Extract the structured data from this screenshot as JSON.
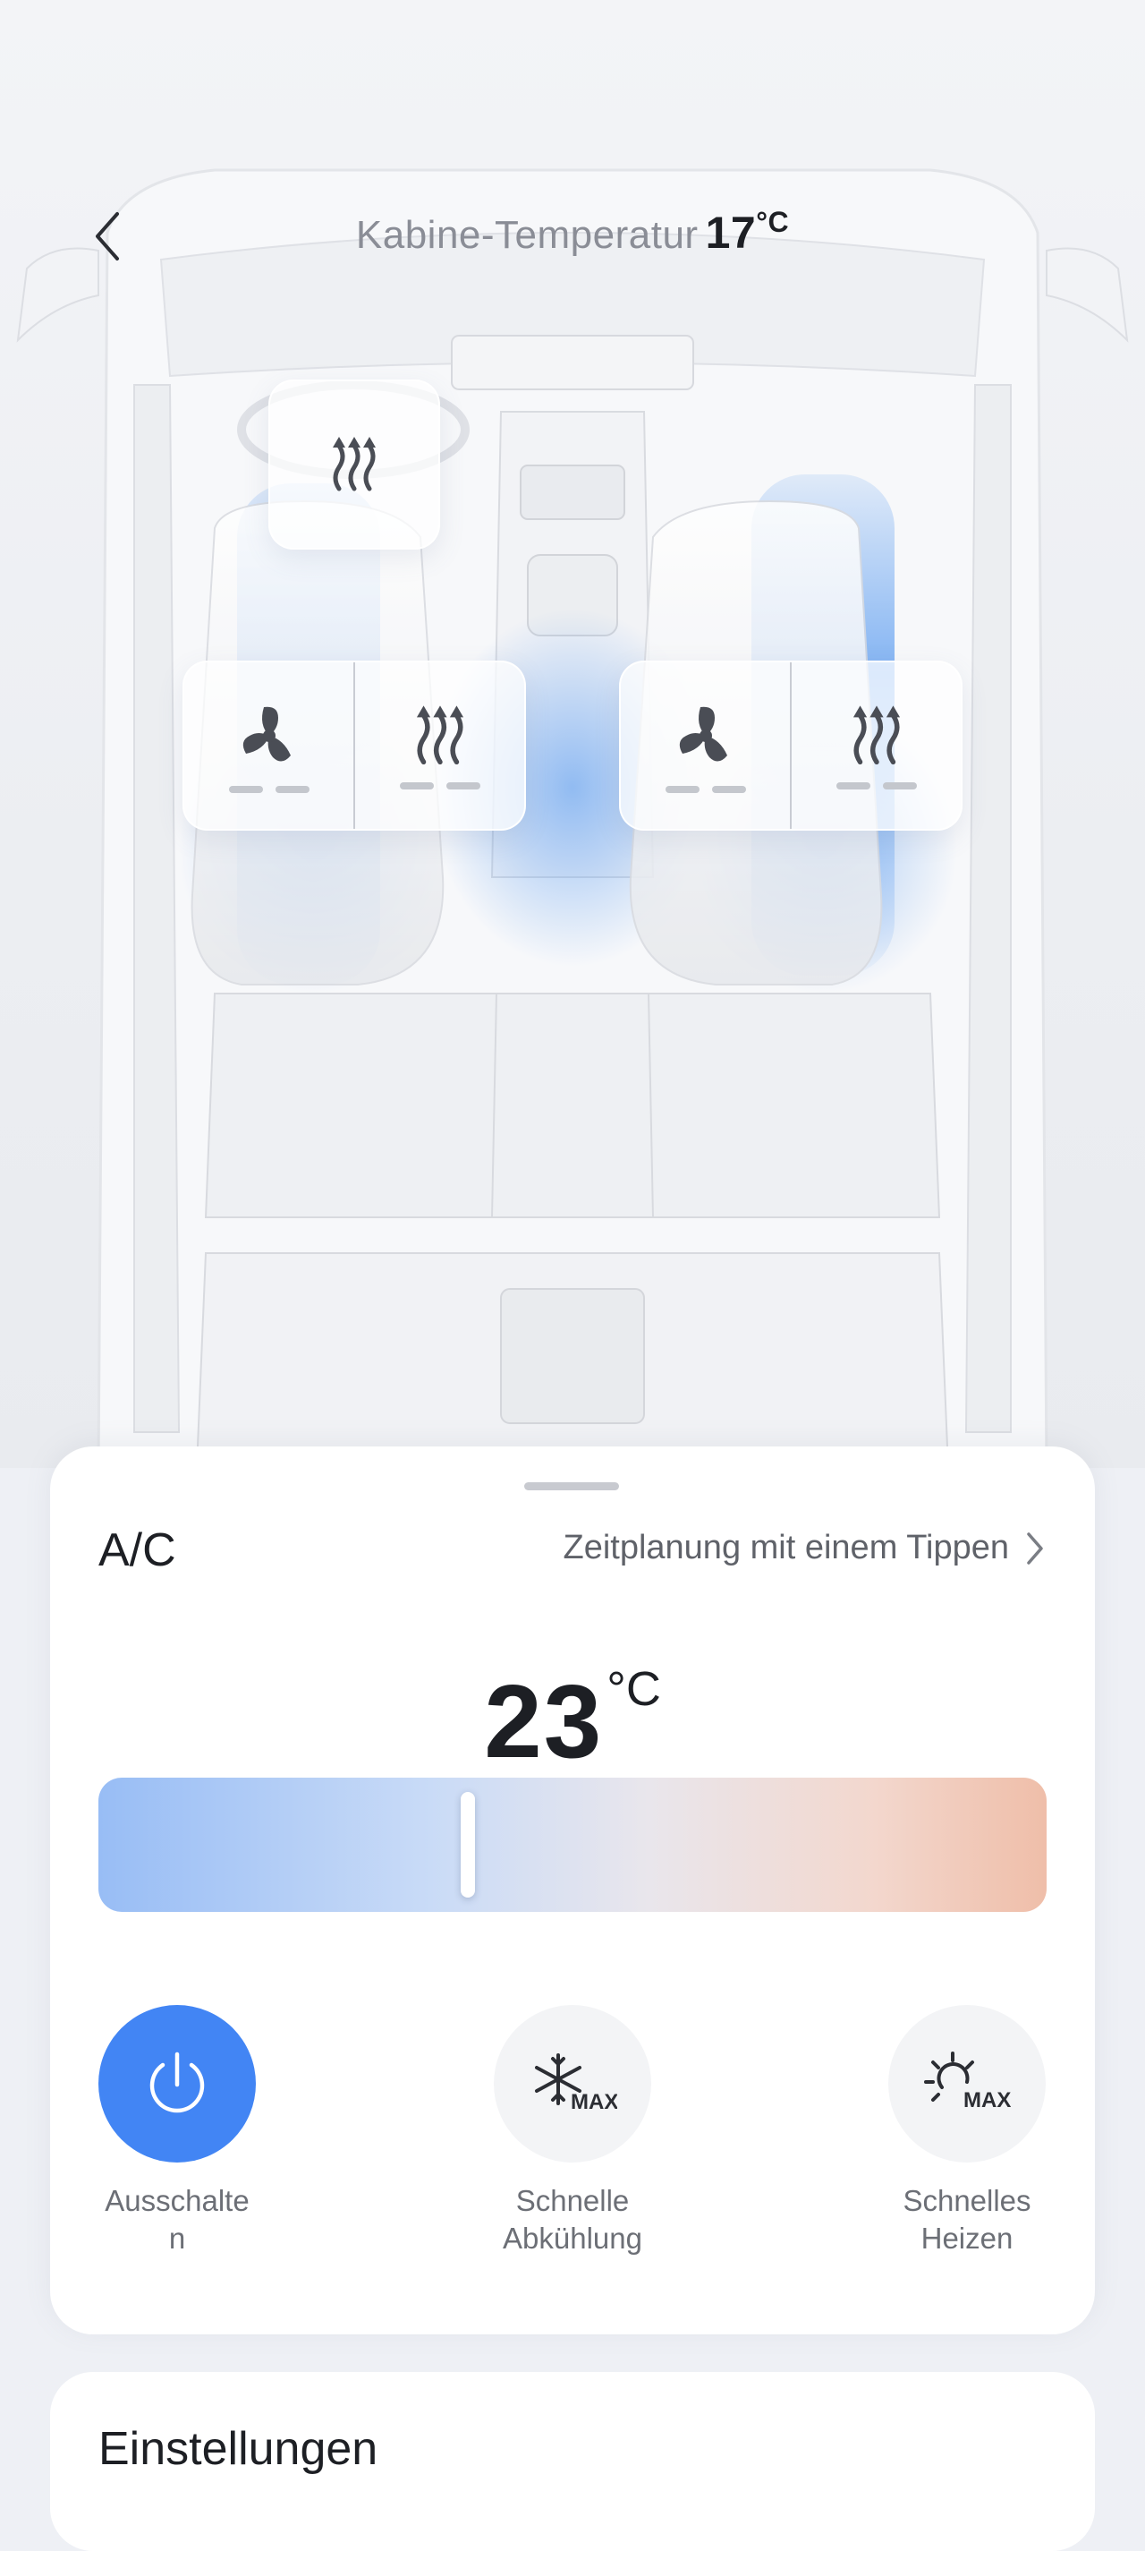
{
  "header": {
    "title": "Kabine-Temperatur",
    "cabin_temp": "17",
    "cabin_temp_unit": "°C"
  },
  "seat_controls": {
    "driver": {
      "fan_level": 0,
      "heat_level": 0,
      "levels_max": 2
    },
    "passenger": {
      "fan_level": 0,
      "heat_level": 0,
      "levels_max": 2
    },
    "steering_wheel_heat": {
      "on": false
    }
  },
  "ac": {
    "label": "A/C",
    "schedule_link": "Zeitplanung mit einem Tippen",
    "set_temp": "23",
    "set_temp_unit": "°C",
    "slider_position": 0.39,
    "modes": [
      {
        "label": "Ausschalte\nn",
        "icon": "power-icon",
        "active": true
      },
      {
        "label": "Schnelle\nAbkühlung",
        "icon": "max-cool-icon",
        "active": false
      },
      {
        "label": "Schnelles\nHeizen",
        "icon": "max-heat-icon",
        "active": false
      }
    ]
  },
  "settings": {
    "title": "Einstellungen"
  },
  "colors": {
    "accent": "#4285f4",
    "airflow": "#5b9cf0",
    "slider_cold": "#98bdf5",
    "slider_hot": "#efbea9"
  }
}
